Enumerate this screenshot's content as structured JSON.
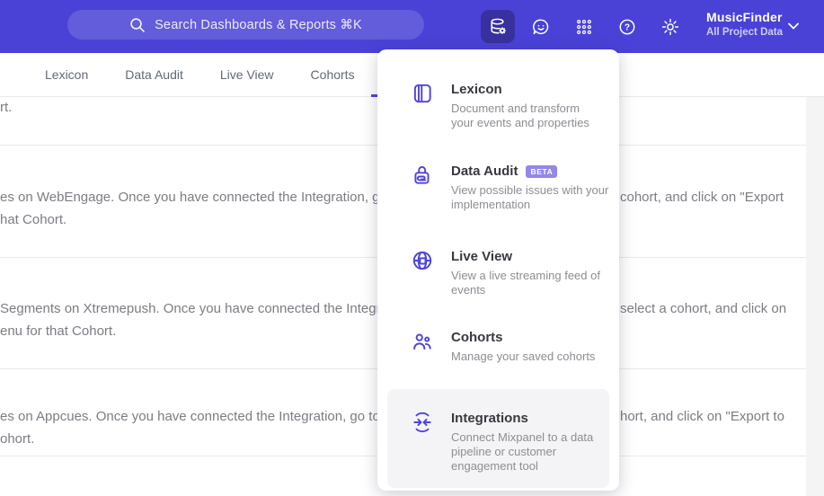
{
  "topbar": {
    "search_placeholder": "Search Dashboards & Reports ⌘K",
    "project_name": "MusicFinder",
    "project_scope": "All Project Data",
    "help_glyph": "?"
  },
  "tabs": {
    "labels": [
      "Lexicon",
      "Data Audit",
      "Live View",
      "Cohorts"
    ]
  },
  "menu": {
    "items": [
      {
        "title": "Lexicon",
        "description": "Document and transform\nyour events and properties"
      },
      {
        "title": "Data Audit",
        "badge": "BETA",
        "description": "View possible issues with your\nimplementation"
      },
      {
        "title": "Live View",
        "description": "View a live streaming feed of\nevents"
      },
      {
        "title": "Cohorts",
        "description": "Manage your saved cohorts"
      },
      {
        "title": "Integrations",
        "description": "Connect Mixpanel to a data\npipeline or customer\nengagement tool",
        "highlighted": true
      }
    ]
  },
  "content": {
    "rows": [
      {
        "line1_left": "rt.",
        "line1_right": "",
        "line2": ""
      },
      {
        "line1_left": "es on WebEngage. Once you have connected the Integration, go to the",
        "line1_right": "cohort, and click on \"Export",
        "line2": "hat Cohort."
      },
      {
        "line1_left": "Segments on Xtremepush. Once you have connected the Integration,",
        "line1_right": "select a cohort, and click on",
        "line2": "enu for that Cohort."
      },
      {
        "line1_left": "es on Appcues. Once you have connected the Integration, go to the M",
        "line1_right": "hort, and click on \"Export to",
        "line2": "ohort."
      }
    ]
  },
  "colors": {
    "topbar_bg": "#4a42d6",
    "accent": "#4f44e0",
    "active_icon_bg": "#38309f",
    "badge_bg": "#9387e9",
    "highlight_bg": "#f4f4f6",
    "gutter_bg": "#f4f4f5",
    "divider": "#e9e9ec",
    "body_text": "#7c7c84",
    "title_text": "#38383f",
    "desc_text": "#8d8d94"
  }
}
